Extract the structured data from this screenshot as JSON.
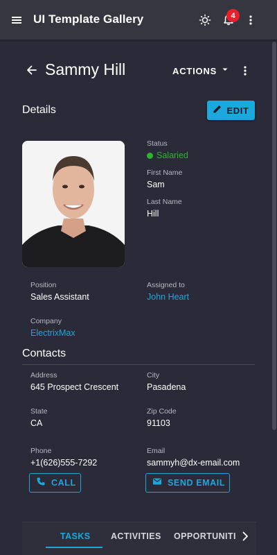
{
  "app": {
    "title": "UI Template Gallery",
    "notification_count": "4"
  },
  "header": {
    "name": "Sammy Hill",
    "actions_label": "ACTIONS"
  },
  "details": {
    "heading": "Details",
    "edit_label": "EDIT",
    "status": {
      "label": "Status",
      "value": "Salaried",
      "color": "#2eb52c"
    },
    "first_name": {
      "label": "First Name",
      "value": "Sam"
    },
    "last_name": {
      "label": "Last Name",
      "value": "Hill"
    },
    "position": {
      "label": "Position",
      "value": "Sales Assistant"
    },
    "assigned_to": {
      "label": "Assigned to",
      "value": "John Heart"
    },
    "company": {
      "label": "Company",
      "value": "ElectrixMax"
    }
  },
  "contacts": {
    "heading": "Contacts",
    "address": {
      "label": "Address",
      "value": "645 Prospect Crescent"
    },
    "city": {
      "label": "City",
      "value": "Pasadena"
    },
    "state": {
      "label": "State",
      "value": "CA"
    },
    "zip": {
      "label": "Zip Code",
      "value": "91103"
    },
    "phone": {
      "label": "Phone",
      "value": "+1(626)555-7292"
    },
    "email": {
      "label": "Email",
      "value": "sammyh@dx-email.com"
    },
    "call_label": "CALL",
    "send_email_label": "SEND EMAIL"
  },
  "tabs": [
    {
      "label": "TASKS",
      "active": true
    },
    {
      "label": "ACTIVITIES",
      "active": false
    },
    {
      "label": "OPPORTUNITIES",
      "active": false
    }
  ],
  "icons": {
    "menu": "menu-icon",
    "theme": "sun-icon",
    "notifications": "bell-icon",
    "more": "more-vertical-icon",
    "back": "arrow-back-icon",
    "dropdown": "caret-down-icon",
    "edit": "pencil-icon",
    "call": "phone-icon",
    "email": "envelope-icon",
    "tab_next": "chevron-right-icon"
  },
  "colors": {
    "accent": "#1ca8dd",
    "background": "#2a2a38",
    "toolbar": "#363640",
    "badge": "#e8202c",
    "success": "#2eb52c"
  }
}
